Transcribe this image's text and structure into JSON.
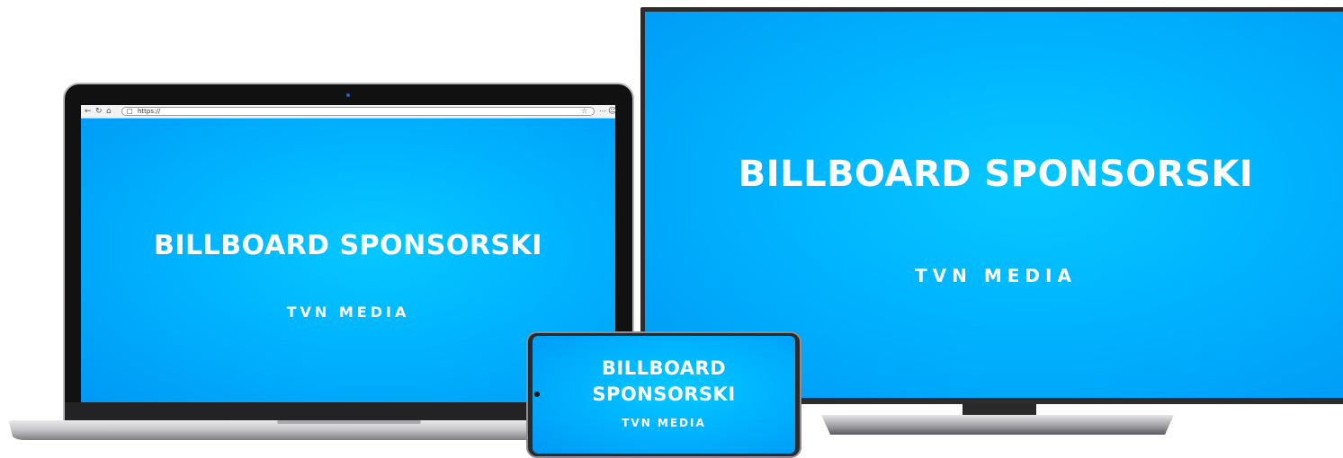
{
  "tv": {
    "title": "BILLBOARD SPONSORSKI",
    "subtitle": "TVN MEDIA"
  },
  "laptop": {
    "browser": {
      "url": "https://",
      "icons": [
        "back-arrow-icon",
        "reload-icon",
        "home-icon",
        "lock-icon",
        "star-icon",
        "more-icon",
        "profile-icon"
      ]
    },
    "title": "BILLBOARD SPONSORSKI",
    "subtitle": "TVN MEDIA"
  },
  "phone": {
    "title_line1": "BILLBOARD",
    "title_line2": "SPONSORSKI",
    "subtitle": "TVN MEDIA"
  },
  "colors": {
    "screen_blue": "#00b4ff",
    "device_frame": "#2c2c2e",
    "text": "#ffffff"
  }
}
